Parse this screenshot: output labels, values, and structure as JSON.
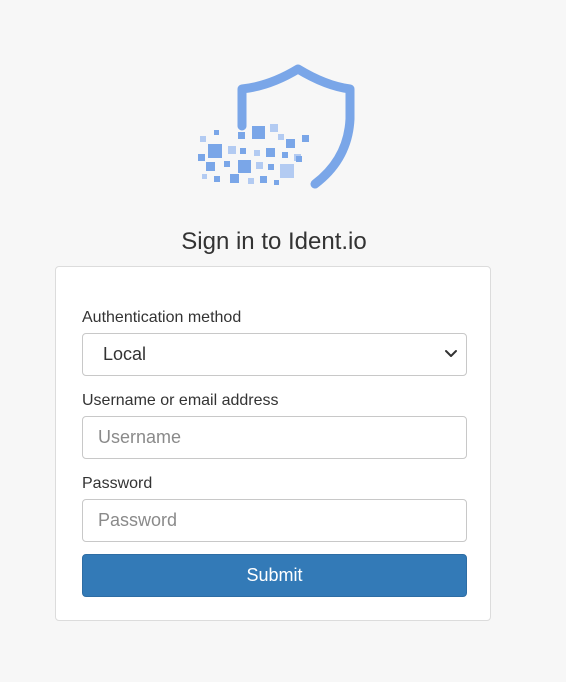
{
  "logo": {
    "icon": "shield-pixel-logo-icon",
    "color_main": "#7aa6e8",
    "color_light": "#b3cbf2"
  },
  "page": {
    "title": "Sign in to Ident.io"
  },
  "form": {
    "auth_method": {
      "label": "Authentication method",
      "selected": "Local",
      "icon": "chevron-down-icon"
    },
    "username": {
      "label": "Username or email address",
      "value": "",
      "placeholder": "Username"
    },
    "password": {
      "label": "Password",
      "value": "",
      "placeholder": "Password"
    },
    "submit_label": "Submit",
    "submit_color": "#337ab7"
  }
}
